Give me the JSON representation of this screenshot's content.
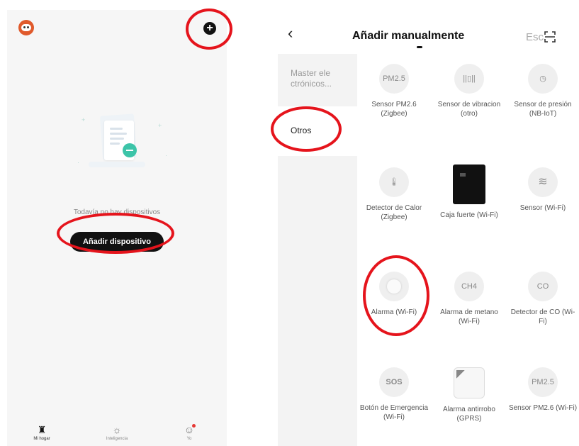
{
  "home": {
    "empty_text": "Todavía no hay dispositivos",
    "add_device_label": "Añadir dispositivo",
    "add_icon": "plus-icon",
    "nav": [
      {
        "label": "Mi hogar",
        "icon": "home-icon"
      },
      {
        "label": "Inteligencia",
        "icon": "sun-icon"
      },
      {
        "label": "Yo",
        "icon": "user-icon"
      }
    ]
  },
  "add_manual": {
    "title": "Añadir manualmente",
    "search_label": "Esca",
    "categories": [
      {
        "label": "Master ele ctrónicos..."
      },
      {
        "label": "Otros"
      }
    ],
    "devices": [
      {
        "icon_text": "PM2.5",
        "name": "Sensor PM2.6 (Zigbee)"
      },
      {
        "icon_text": "",
        "name": "Sensor de vibracion (otro)"
      },
      {
        "icon_text": "",
        "name": "Sensor de presión (NB-IoT)"
      },
      {
        "icon_text": "",
        "name": "Detector de Calor (Zigbee)"
      },
      {
        "icon_text": "",
        "name": "Caja fuerte (Wi-Fi)"
      },
      {
        "icon_text": "≋",
        "name": "Sensor (Wi-Fi)"
      },
      {
        "icon_text": "",
        "name": "Alarma (Wi-Fi)"
      },
      {
        "icon_text": "CH4",
        "name": "Alarma de metano (Wi-Fi)"
      },
      {
        "icon_text": "CO",
        "name": "Detector de CO (Wi-Fi)"
      },
      {
        "icon_text": "SOS",
        "name": "Botón de Emergencia (Wi-Fi)"
      },
      {
        "icon_text": "",
        "name": "Alarma antirrobo (GPRS)"
      },
      {
        "icon_text": "PM2.5",
        "name": "Sensor PM2.6 (Wi-Fi)"
      }
    ]
  },
  "colors": {
    "highlight": "#e5141c",
    "button": "#111111",
    "accent": "#3cc4a8"
  }
}
